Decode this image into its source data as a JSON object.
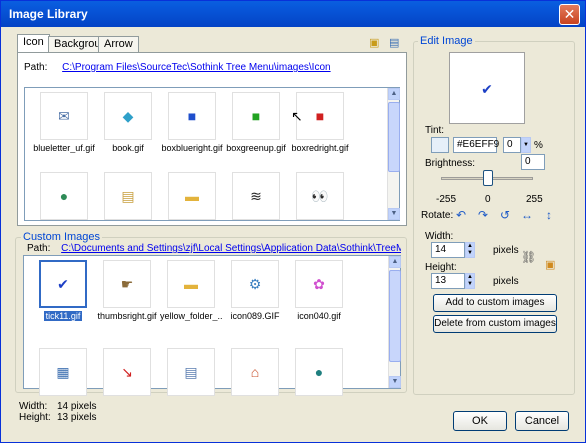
{
  "window": {
    "title": "Image Library",
    "close_glyph": "✕"
  },
  "tabs": [
    {
      "label": "Icon",
      "active": true
    },
    {
      "label": "Background",
      "active": false
    },
    {
      "label": "Arrow",
      "active": false
    }
  ],
  "library": {
    "path_label": "Path:",
    "path_value": "C:\\Program Files\\SourceTec\\Sothink Tree Menu\\images\\Icon",
    "items_row1": [
      {
        "name": "blueletter_uf.gif",
        "icon": "envelope-icon",
        "glyph": "✉"
      },
      {
        "name": "book.gif",
        "icon": "book-icon",
        "glyph": "◆"
      },
      {
        "name": "boxblueright.gif",
        "icon": "box-blue-icon",
        "glyph": "■"
      },
      {
        "name": "boxgreenup.gif",
        "icon": "box-green-icon",
        "glyph": "■"
      },
      {
        "name": "boxredright.gif",
        "icon": "box-red-icon",
        "glyph": "■"
      }
    ],
    "items_row2": [
      {
        "name": "",
        "icon": "globe-icon",
        "glyph": "●"
      },
      {
        "name": "",
        "icon": "document-icon",
        "glyph": "▤"
      },
      {
        "name": "",
        "icon": "folder-icon",
        "glyph": "▬"
      },
      {
        "name": "",
        "icon": "scribble-icon",
        "glyph": "≋"
      },
      {
        "name": "",
        "icon": "eyes-icon",
        "glyph": "👀"
      }
    ]
  },
  "custom": {
    "label": "Custom Images",
    "path_label": "Path:",
    "path_value": "C:\\Documents and Settings\\zjf\\Local Settings\\Application Data\\Sothink\\TreeMenu\\Images\\Cust...",
    "items_row1": [
      {
        "name": "tick11.gif",
        "icon": "checkmark-icon",
        "glyph": "✔",
        "selected": true
      },
      {
        "name": "thumbsright.gif",
        "icon": "thumbs-icon",
        "glyph": "☛",
        "selected": false
      },
      {
        "name": "yellow_folder_...",
        "icon": "yellow-folder-icon",
        "glyph": "▬",
        "selected": false
      },
      {
        "name": "icon089.GIF",
        "icon": "gear-icon",
        "glyph": "⚙",
        "selected": false
      },
      {
        "name": "icon040.gif",
        "icon": "flower-icon",
        "glyph": "✿",
        "selected": false
      }
    ],
    "items_row2": [
      {
        "name": "",
        "icon": "user-doc-icon",
        "glyph": "▦"
      },
      {
        "name": "",
        "icon": "red-arrow-icon",
        "glyph": "↘"
      },
      {
        "name": "",
        "icon": "notepad-icon",
        "glyph": "▤"
      },
      {
        "name": "",
        "icon": "house-icon",
        "glyph": "⌂"
      },
      {
        "name": "",
        "icon": "teal-ball-icon",
        "glyph": "●"
      }
    ]
  },
  "status": {
    "width_label": "Width:",
    "width_value": "14 pixels",
    "height_label": "Height:",
    "height_value": "13 pixels"
  },
  "edit": {
    "group_label": "Edit Image",
    "preview_glyph": "✔",
    "tint_label": "Tint:",
    "tint_value": "#E6EFF9",
    "tint_percent": "0",
    "percent_sign": "%",
    "brightness_label": "Brightness:",
    "brightness_value": "0",
    "brightness_ticks": [
      "-255",
      "0",
      "255"
    ],
    "rotate_label": "Rotate:",
    "width_label": "Width:",
    "width_value": "14",
    "height_label": "Height:",
    "height_value": "13",
    "pixels_label": "pixels",
    "add_button": "Add to custom images",
    "delete_button": "Delete from custom images"
  },
  "footer": {
    "ok": "OK",
    "cancel": "Cancel"
  }
}
